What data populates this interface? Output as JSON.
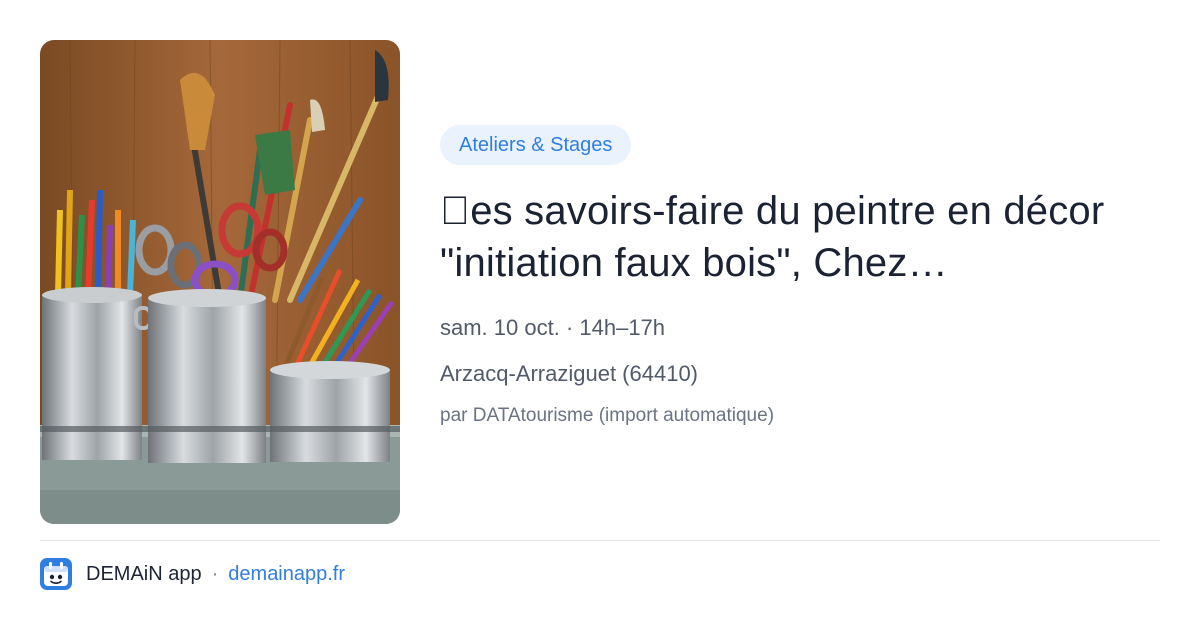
{
  "event": {
    "category": "Ateliers & Stages",
    "title": "\u0000es savoirs-faire du peintre en décor \"initiation faux bois\", Chez…",
    "when": "sam. 10 oct. · 14h–17h",
    "where": "Arzacq-Arraziguet (64410)",
    "source": "par DATAtourisme (import automatique)"
  },
  "image": {
    "subject": "jars of brushes, colored pencils and scissors"
  },
  "footer": {
    "app_name": "DEMAiN app",
    "separator": "·",
    "link_text": "demainapp.fr",
    "logo_icon": "demain-app-logo-icon"
  },
  "colors": {
    "accent": "#2f7ee0",
    "badge_bg": "#eaf2fd",
    "text": "#1b2233",
    "muted": "#525a6a"
  }
}
